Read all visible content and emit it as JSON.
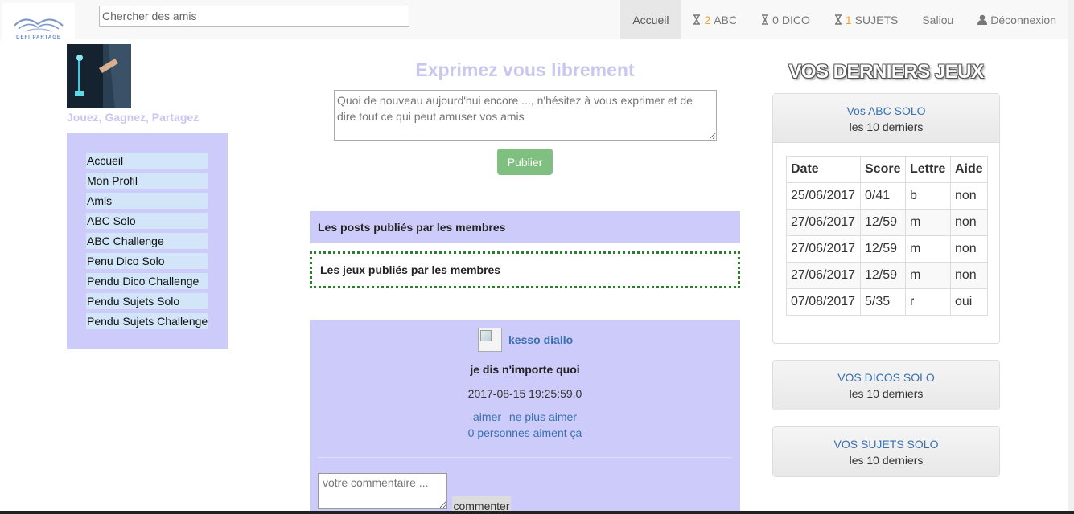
{
  "navbar": {
    "logo_text": "DEFI PARTAGE",
    "search_placeholder": "Chercher des amis",
    "items": [
      {
        "label": "Accueil",
        "active": true
      },
      {
        "count": "2",
        "label": "ABC",
        "icon": "hourglass-icon"
      },
      {
        "count": "0",
        "label": "DICO",
        "icon": "hourglass-icon"
      },
      {
        "count": "1",
        "label": "SUJETS",
        "icon": "hourglass-icon"
      },
      {
        "label": "Saliou"
      },
      {
        "label": "Déconnexion",
        "icon": "user-icon"
      }
    ]
  },
  "sidebar": {
    "tagline": "Jouez, Gagnez, Partagez",
    "menu": [
      "Accueil",
      "Mon Profil",
      "Amis",
      "ABC Solo",
      "ABC Challenge",
      "Penu Dico Solo",
      "Pendu Dico Challenge",
      "Pendu Sujets Solo",
      "Pendu Sujets Challenge"
    ]
  },
  "main": {
    "title": "Exprimez vous librement",
    "post_placeholder": "Quoi de nouveau aujourd'hui encore ..., n'hésitez à vous exprimer et de dire tout ce qui peut amuser vos amis",
    "publish_label": "Publier",
    "posts_header": "Les posts publiés par les membres",
    "games_header": "Les jeux publiés par les membres",
    "post": {
      "author": "kesso diallo",
      "body": "je dis n'importe quoi",
      "date": "2017-08-15 19:25:59.0",
      "like_label": "aimer",
      "unlike_label": "ne plus aimer",
      "likes_text": "0 personnes aiment ça",
      "comment_placeholder": "votre commentaire ...",
      "comment_button": "commenter"
    }
  },
  "right": {
    "title": "VOS DERNIERS JEUX",
    "abc_panel": {
      "title": "Vos ABC SOLO",
      "subtitle": "les 10 derniers"
    },
    "table": {
      "headers": [
        "Date",
        "Score",
        "Lettre",
        "Aide"
      ],
      "rows": [
        [
          "25/06/2017",
          "0/41",
          "b",
          "non"
        ],
        [
          "27/06/2017",
          "12/59",
          "m",
          "non"
        ],
        [
          "27/06/2017",
          "12/59",
          "m",
          "non"
        ],
        [
          "27/06/2017",
          "12/59",
          "m",
          "non"
        ],
        [
          "07/08/2017",
          "5/35",
          "r",
          "oui"
        ]
      ]
    },
    "dico_panel": {
      "title": "VOS DICOS SOLO",
      "subtitle": "les 10 derniers"
    },
    "sujets_panel": {
      "title": "VOS SUJETS SOLO",
      "subtitle": "les 10 derniers"
    }
  },
  "colors": {
    "lavender": "#cccbf9",
    "menu_item_bg": "#d2e5f9",
    "publish_green": "#7fbf7f",
    "link_blue": "#3a6fb0",
    "count_orange": "#f0a030",
    "dotted_green": "#2d7d2d"
  }
}
